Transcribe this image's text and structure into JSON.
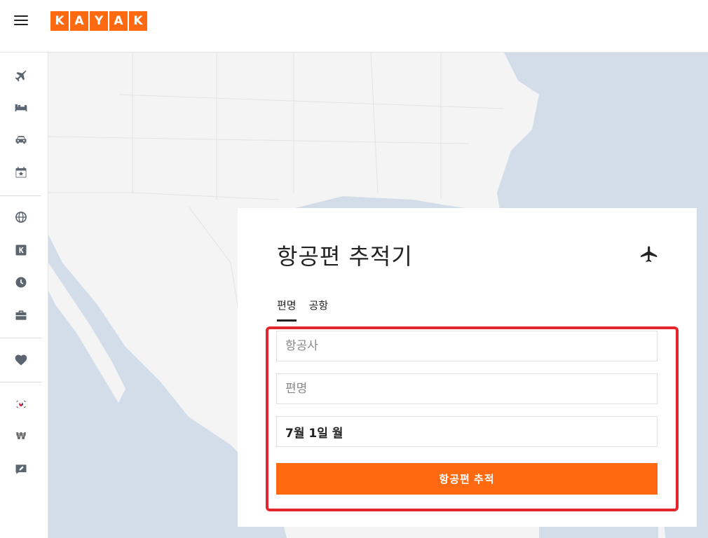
{
  "header": {
    "logo_letters": [
      "K",
      "A",
      "Y",
      "A",
      "K"
    ],
    "brand_color": "#ff690f"
  },
  "sidebar": {
    "items": [
      {
        "icon": "airplane-icon"
      },
      {
        "icon": "bed-icon"
      },
      {
        "icon": "car-icon"
      },
      {
        "icon": "calendar-star-icon"
      },
      {
        "icon": "globe-icon"
      },
      {
        "icon": "kayak-k-icon"
      },
      {
        "icon": "clock-icon"
      },
      {
        "icon": "briefcase-icon"
      },
      {
        "icon": "heart-icon"
      },
      {
        "icon": "korea-flag-icon"
      },
      {
        "icon": "won-currency-icon",
        "label": "₩"
      },
      {
        "icon": "feedback-edit-icon"
      }
    ]
  },
  "card": {
    "title": "항공편 추적기",
    "tabs": [
      {
        "label": "편명",
        "active": true
      },
      {
        "label": "공항",
        "active": false
      }
    ],
    "airline_placeholder": "항공사",
    "flight_number_placeholder": "편명",
    "date_value": "7월 1일 월",
    "track_button_label": "항공편 추적"
  },
  "colors": {
    "accent": "#ff690f",
    "highlight": "#e3252d",
    "water": "#d3dde9",
    "land": "#f4f4f4"
  }
}
